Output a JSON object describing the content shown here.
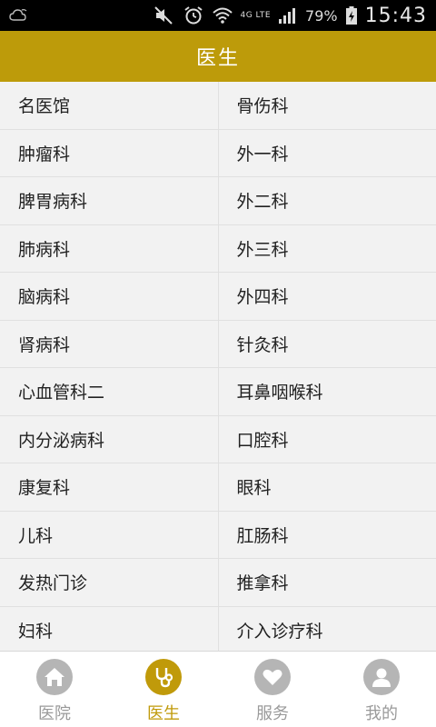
{
  "status_bar": {
    "network": "4G LTE",
    "battery": "79%",
    "time": "15:43"
  },
  "header": {
    "title": "医生"
  },
  "departments": [
    [
      "名医馆",
      "骨伤科"
    ],
    [
      "肿瘤科",
      "外一科"
    ],
    [
      "脾胃病科",
      "外二科"
    ],
    [
      "肺病科",
      "外三科"
    ],
    [
      "脑病科",
      "外四科"
    ],
    [
      "肾病科",
      "针灸科"
    ],
    [
      "心血管科二",
      "耳鼻咽喉科"
    ],
    [
      "内分泌病科",
      "口腔科"
    ],
    [
      "康复科",
      "眼科"
    ],
    [
      "儿科",
      "肛肠科"
    ],
    [
      "发热门诊",
      "推拿科"
    ],
    [
      "妇科",
      "介入诊疗科"
    ]
  ],
  "tabs": [
    {
      "label": "医院",
      "icon": "home-icon",
      "active": false
    },
    {
      "label": "医生",
      "icon": "stethoscope-icon",
      "active": true
    },
    {
      "label": "服务",
      "icon": "heart-icon",
      "active": false
    },
    {
      "label": "我的",
      "icon": "person-icon",
      "active": false
    }
  ],
  "colors": {
    "accent": "#bd9b0a",
    "tab_inactive": "#b5b5b5",
    "statusbar": "#000000"
  }
}
